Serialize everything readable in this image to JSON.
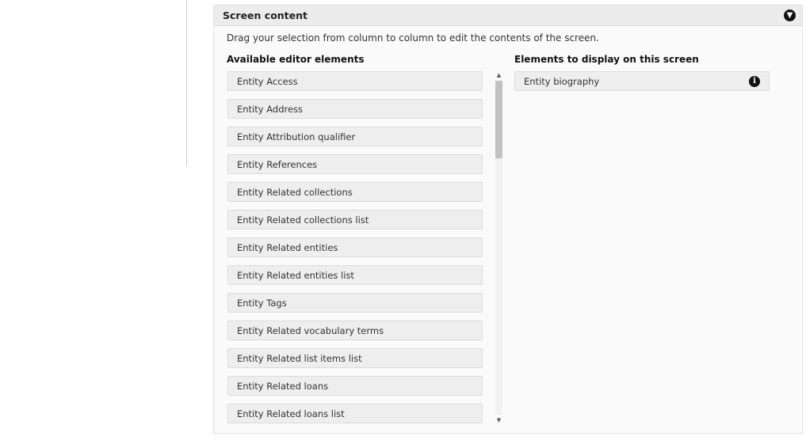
{
  "panel": {
    "title": "Screen content",
    "instructions": "Drag your selection from column to column to edit the contents of the screen.",
    "available_title": "Available editor elements",
    "display_title": "Elements to display on this screen"
  },
  "available_items": [
    {
      "label": "Entity Access"
    },
    {
      "label": "Entity Address"
    },
    {
      "label": "Entity Attribution qualifier"
    },
    {
      "label": "Entity References"
    },
    {
      "label": "Entity Related collections"
    },
    {
      "label": "Entity Related collections list"
    },
    {
      "label": "Entity Related entities"
    },
    {
      "label": "Entity Related entities list"
    },
    {
      "label": "Entity Tags"
    },
    {
      "label": "Entity Related vocabulary terms"
    },
    {
      "label": "Entity Related list items list"
    },
    {
      "label": "Entity Related loans"
    },
    {
      "label": "Entity Related loans list"
    }
  ],
  "display_items": [
    {
      "label": "Entity biography"
    }
  ],
  "icons": {
    "collapse": "arrow-circle-down-icon",
    "info": "info-circle-icon",
    "scroll_up": "triangle-up-icon",
    "scroll_down": "triangle-down-icon"
  }
}
